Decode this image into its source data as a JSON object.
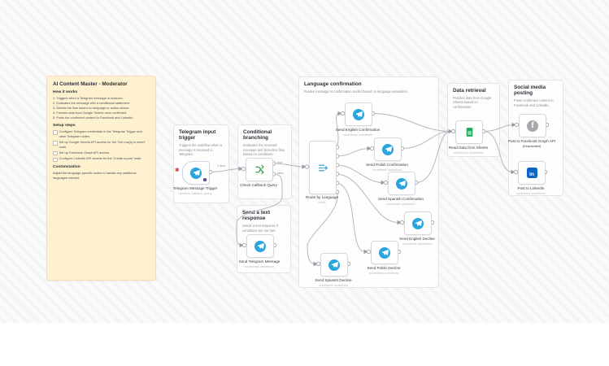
{
  "sticky": {
    "title": "AI Content Master - Moderator",
    "how_heading": "How it works",
    "how_items": [
      "1. Triggers when a Telegram message is received.",
      "2. Evaluates the message with a conditional statement.",
      "3. Directs the flow based on language or action choice.",
      "4. Fetches data from Google Sheets once confirmed.",
      "5. Posts the confirmed content to Facebook and LinkedIn."
    ],
    "setup_heading": "Setup steps",
    "setup_items": [
      "Configure Telegram credentials in the Telegram Trigger and other Telegram nodes.",
      "Set up Google Sheets API access for the 'Get row(s) in sheet' node.",
      "Set up Facebook Graph API access.",
      "Configure LinkedIn API access for the 'Create a post' node."
    ],
    "custom_heading": "Customization",
    "custom_text": "Adjust the language-specific nodes to handle any additional languages needed."
  },
  "groups": [
    {
      "title": "Telegram input trigger",
      "description": "Triggers the workflow when a message is received in Telegram."
    },
    {
      "title": "Conditional branching",
      "description": "Evaluates the received message and branches flow based on conditions."
    },
    {
      "title": "Send a text response",
      "description": "Sends a text response if conditions are not met."
    },
    {
      "title": "Language confirmation",
      "description": "Routes message to confirmation nodes based on language evaluation."
    },
    {
      "title": "Data retrieval",
      "description": "Fetches data from Google Sheets based on confirmation."
    },
    {
      "title": "Social media posting",
      "description": "Posts confirmed content to Facebook and LinkedIn."
    }
  ],
  "nodes": [
    {
      "name": "Telegram Message Trigger",
      "subtitle": "Updates: callback_query"
    },
    {
      "name": "Check Callback Query",
      "subtitle": ""
    },
    {
      "name": "Send Telegram Message",
      "subtitle": "undefined: undefined"
    },
    {
      "name": "Route by Language",
      "subtitle": "mode"
    },
    {
      "name": "Send English Confirmation",
      "subtitle": "undefined: undefined"
    },
    {
      "name": "Send Polish Confirmation",
      "subtitle": "undefined: undefined"
    },
    {
      "name": "Send Spanish Confirmation",
      "subtitle": "undefined: undefined"
    },
    {
      "name": "Send English Decline",
      "subtitle": "undefined: undefined"
    },
    {
      "name": "Send Polish Decline",
      "subtitle": "undefined: undefined"
    },
    {
      "name": "Send Spanish Decline",
      "subtitle": "undefined: undefined"
    },
    {
      "name": "Read Data from Sheets",
      "subtitle": "undefined: undefined"
    },
    {
      "name": "Post to Facebook Graph API",
      "subtitle": "(Deactivated)"
    },
    {
      "name": "Post to LinkedIn",
      "subtitle": "undefined: undefined"
    }
  ],
  "wire_labels": {
    "one_item": "1 item",
    "true": "true",
    "false": "false"
  },
  "icons": {
    "error_marker": "✱"
  },
  "colors": {
    "telegram": "#2aa5de",
    "if_green": "#3f9e53",
    "switch_blue": "#419fd9",
    "sheets_green": "#1faa5e",
    "linkedin_blue": "#0a66c2",
    "sticky_bg": "#fdf1d0"
  }
}
